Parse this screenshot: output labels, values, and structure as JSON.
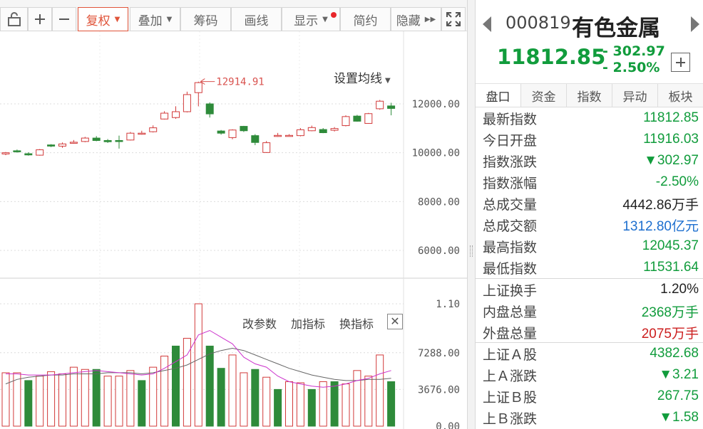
{
  "toolbar": {
    "rights_label": "复权",
    "overlay_label": "叠加",
    "chips_label": "筹码",
    "draw_label": "画线",
    "display_label": "显示",
    "simple_label": "简约",
    "hide_label": "隐藏"
  },
  "chart": {
    "ma_setting_label": "设置均线",
    "price_axis": [
      "12000.00",
      "10000.00",
      "8000.00",
      "6000.00"
    ],
    "high_annotation": "12914.91",
    "volume_axis": [
      "1.10",
      "7288.00",
      "3676.00",
      "0.00"
    ],
    "indicator_toolbar": {
      "change_params": "改参数",
      "add_indicator": "加指标",
      "switch_indicator": "换指标"
    },
    "colors": {
      "up": "#d23a3a",
      "down": "#2e8b3a",
      "ma1": "#cc33cc",
      "ma2": "#666666"
    }
  },
  "chart_data": {
    "type": "candlestick",
    "y_ticks": [
      12000,
      10000,
      8000,
      6000
    ],
    "annotated_high": 12914.91,
    "candles": [
      {
        "o": 9950,
        "c": 10000,
        "h": 10030,
        "l": 9900
      },
      {
        "o": 10080,
        "c": 10050,
        "h": 10130,
        "l": 10000
      },
      {
        "o": 9960,
        "c": 9910,
        "h": 10020,
        "l": 9880
      },
      {
        "o": 9900,
        "c": 10120,
        "h": 10150,
        "l": 9880
      },
      {
        "o": 10320,
        "c": 10270,
        "h": 10350,
        "l": 10230
      },
      {
        "o": 10270,
        "c": 10360,
        "h": 10420,
        "l": 10200
      },
      {
        "o": 10400,
        "c": 10430,
        "h": 10520,
        "l": 10370
      },
      {
        "o": 10460,
        "c": 10600,
        "h": 10650,
        "l": 10430
      },
      {
        "o": 10600,
        "c": 10500,
        "h": 10680,
        "l": 10470
      },
      {
        "o": 10500,
        "c": 10450,
        "h": 10560,
        "l": 10400
      },
      {
        "o": 10500,
        "c": 10460,
        "h": 10700,
        "l": 10170
      },
      {
        "o": 10520,
        "c": 10800,
        "h": 10850,
        "l": 10500
      },
      {
        "o": 10780,
        "c": 10800,
        "h": 10900,
        "l": 10740
      },
      {
        "o": 10860,
        "c": 11020,
        "h": 11120,
        "l": 10830
      },
      {
        "o": 11380,
        "c": 11620,
        "h": 11700,
        "l": 11360
      },
      {
        "o": 11440,
        "c": 11680,
        "h": 11900,
        "l": 11390
      },
      {
        "o": 11680,
        "c": 12380,
        "h": 12500,
        "l": 11650
      },
      {
        "o": 12460,
        "c": 12870,
        "h": 12910,
        "l": 11900
      },
      {
        "o": 12000,
        "c": 11590,
        "h": 12060,
        "l": 11440
      },
      {
        "o": 10890,
        "c": 10800,
        "h": 10930,
        "l": 10740
      },
      {
        "o": 10620,
        "c": 10930,
        "h": 10960,
        "l": 10550
      },
      {
        "o": 11080,
        "c": 10900,
        "h": 11100,
        "l": 10850
      },
      {
        "o": 10700,
        "c": 10420,
        "h": 10760,
        "l": 10310
      },
      {
        "o": 10010,
        "c": 10410,
        "h": 10480,
        "l": 9990
      },
      {
        "o": 10690,
        "c": 10710,
        "h": 10810,
        "l": 10650
      },
      {
        "o": 10680,
        "c": 10710,
        "h": 10760,
        "l": 10660
      },
      {
        "o": 10700,
        "c": 10940,
        "h": 11010,
        "l": 10670
      },
      {
        "o": 10900,
        "c": 11030,
        "h": 11110,
        "l": 10880
      },
      {
        "o": 10950,
        "c": 10820,
        "h": 11010,
        "l": 10800
      },
      {
        "o": 10920,
        "c": 10990,
        "h": 11050,
        "l": 10870
      },
      {
        "o": 11110,
        "c": 11480,
        "h": 11530,
        "l": 11080
      },
      {
        "o": 11500,
        "c": 11290,
        "h": 11550,
        "l": 11270
      },
      {
        "o": 11200,
        "c": 11600,
        "h": 11630,
        "l": 11190
      },
      {
        "o": 11800,
        "c": 12110,
        "h": 12160,
        "l": 11760
      },
      {
        "o": 11916.03,
        "c": 11812.85,
        "h": 12045.37,
        "l": 11531.64
      }
    ],
    "volume_ticks": [
      "1.10",
      "7288.00",
      "3676.00",
      "0.00"
    ],
    "volume": [
      {
        "v": 0.48,
        "up": true
      },
      {
        "v": 0.48,
        "up": true
      },
      {
        "v": 0.41,
        "up": false
      },
      {
        "v": 0.45,
        "up": true
      },
      {
        "v": 0.49,
        "up": true
      },
      {
        "v": 0.47,
        "up": true
      },
      {
        "v": 0.53,
        "up": true
      },
      {
        "v": 0.51,
        "up": true
      },
      {
        "v": 0.51,
        "up": false
      },
      {
        "v": 0.45,
        "up": true
      },
      {
        "v": 0.45,
        "up": true
      },
      {
        "v": 0.5,
        "up": true
      },
      {
        "v": 0.41,
        "up": false
      },
      {
        "v": 0.53,
        "up": true
      },
      {
        "v": 0.63,
        "up": true
      },
      {
        "v": 0.72,
        "up": false
      },
      {
        "v": 0.79,
        "up": true
      },
      {
        "v": 1.1,
        "up": true
      },
      {
        "v": 0.72,
        "up": false
      },
      {
        "v": 0.52,
        "up": false
      },
      {
        "v": 0.64,
        "up": true
      },
      {
        "v": 0.48,
        "up": true
      },
      {
        "v": 0.51,
        "up": false
      },
      {
        "v": 0.44,
        "up": true
      },
      {
        "v": 0.33,
        "up": false
      },
      {
        "v": 0.4,
        "up": true
      },
      {
        "v": 0.39,
        "up": true
      },
      {
        "v": 0.33,
        "up": false
      },
      {
        "v": 0.4,
        "up": true
      },
      {
        "v": 0.4,
        "up": false
      },
      {
        "v": 0.38,
        "up": true
      },
      {
        "v": 0.5,
        "up": true
      },
      {
        "v": 0.45,
        "up": true
      },
      {
        "v": 0.64,
        "up": true
      },
      {
        "v": 0.4,
        "up": false
      }
    ],
    "ma_volume_fast": [
      0.47,
      0.47,
      0.46,
      0.46,
      0.46,
      0.47,
      0.48,
      0.49,
      0.5,
      0.49,
      0.48,
      0.47,
      0.46,
      0.47,
      0.52,
      0.58,
      0.64,
      0.82,
      0.86,
      0.8,
      0.74,
      0.62,
      0.56,
      0.53,
      0.45,
      0.4,
      0.38,
      0.36,
      0.35,
      0.36,
      0.38,
      0.41,
      0.43,
      0.47,
      0.5
    ],
    "ma_volume_slow": [
      0.38,
      0.42,
      0.44,
      0.45,
      0.46,
      0.46,
      0.47,
      0.47,
      0.47,
      0.48,
      0.48,
      0.48,
      0.47,
      0.48,
      0.5,
      0.52,
      0.55,
      0.6,
      0.65,
      0.68,
      0.7,
      0.68,
      0.64,
      0.6,
      0.56,
      0.52,
      0.49,
      0.46,
      0.44,
      0.42,
      0.41,
      0.41,
      0.42,
      0.42,
      0.43
    ]
  },
  "quote": {
    "code": "000819",
    "name": "有色金属",
    "last": "11812.85",
    "change": "- 302.97",
    "change_pct": "- 2.50%"
  },
  "tabs": [
    "盘口",
    "资金",
    "指数",
    "异动",
    "板块"
  ],
  "details": [
    {
      "label": "最新指数",
      "value": "11812.85",
      "color": "green"
    },
    {
      "label": "今日开盘",
      "value": "11916.03",
      "color": "green"
    },
    {
      "label": "指数涨跌",
      "value": "▼302.97",
      "color": "green"
    },
    {
      "label": "指数涨幅",
      "value": "-2.50%",
      "color": "green"
    },
    {
      "label": "总成交量",
      "value": "4442.86万手",
      "color": "black"
    },
    {
      "label": "总成交额",
      "value": "1312.80亿元",
      "color": "blue"
    },
    {
      "label": "最高指数",
      "value": "12045.37",
      "color": "green"
    },
    {
      "label": "最低指数",
      "value": "11531.64",
      "color": "green"
    }
  ],
  "details2": [
    {
      "label": "上证换手",
      "value": "1.20%",
      "color": "black"
    },
    {
      "label": "内盘总量",
      "value": "2368万手",
      "color": "green"
    },
    {
      "label": "外盘总量",
      "value": "2075万手",
      "color": "red"
    }
  ],
  "details3": [
    {
      "label": "上证Ａ股",
      "value": "4382.68",
      "color": "green"
    },
    {
      "label": "上Ａ涨跌",
      "value": "▼3.21",
      "color": "green"
    },
    {
      "label": "上证Ｂ股",
      "value": "267.75",
      "color": "green"
    },
    {
      "label": "上Ｂ涨跌",
      "value": "▼1.58",
      "color": "green"
    }
  ]
}
